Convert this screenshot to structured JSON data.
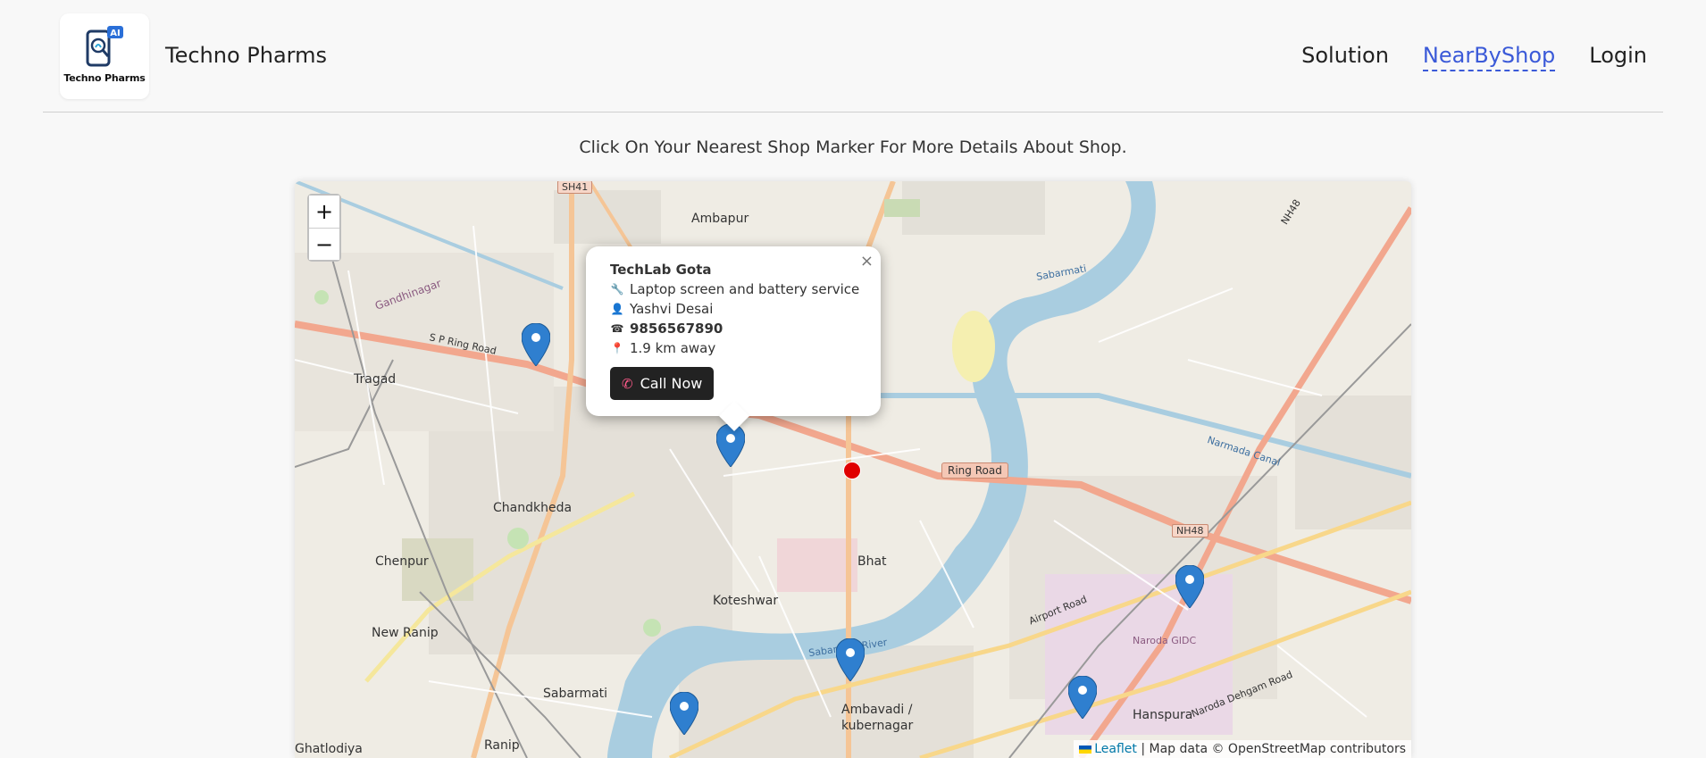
{
  "brand": {
    "logo_text": "Techno Pharms",
    "logo_badge": "AI",
    "name": "Techno Pharms"
  },
  "nav": {
    "items": [
      {
        "label": "Solution",
        "active": false
      },
      {
        "label": "NearByShop",
        "active": true
      },
      {
        "label": "Login",
        "active": false
      }
    ]
  },
  "instruction": "Click On Your Nearest Shop Marker For More Details About Shop.",
  "map": {
    "zoom_in": "+",
    "zoom_out": "−",
    "place_labels": [
      "Ambapur",
      "Tragad",
      "Chandkheda",
      "Chenpur",
      "New Ranip",
      "Koteshwar",
      "Bhat",
      "Sabarmati",
      "Ranip",
      "Ambavadi /",
      "kubernagar",
      "Hanspura",
      "Naroda GIDC",
      "Ghatlodiya",
      "Gandhinagar",
      "Sabarmati",
      "Sabarmati River",
      "Narmada Canal",
      "Airport Road",
      "Naroda Dehgam Road"
    ],
    "road_labels": {
      "ring_road": "Ring Road",
      "sh41": "SH41",
      "nh48_a": "NH48",
      "nh48_b": "NH48",
      "sp_ring": "S P Ring Road"
    },
    "popup": {
      "title": "TechLab Gota",
      "service": "Laptop screen and battery service",
      "owner": "Yashvi Desai",
      "phone": "9856567890",
      "distance": "1.9 km away",
      "call_label": "Call Now",
      "close": "×"
    },
    "attribution": {
      "leaflet": "Leaflet",
      "text": "| Map data © OpenStreetMap contributors"
    },
    "marker_color": "#2f7fcf",
    "user_color": "#e00000"
  }
}
